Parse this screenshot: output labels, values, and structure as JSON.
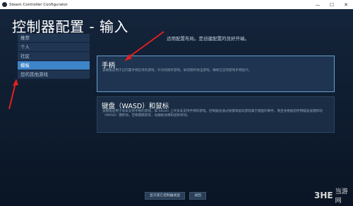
{
  "window": {
    "title": "Steam Controller Configurator",
    "buttons": [
      "—",
      "☐",
      "✕"
    ]
  },
  "page_title": "控制器配置 - 输入",
  "sidebar": {
    "items": [
      {
        "label": "推荐",
        "active": false
      },
      {
        "label": "个人",
        "active": false
      },
      {
        "label": "社区",
        "active": false
      },
      {
        "label": "模板",
        "active": true
      },
      {
        "label": "您的其他游戏",
        "active": false
      }
    ]
  },
  "hint": "适用配置布局。是创建配置的良好开端。",
  "cards": [
    {
      "title": "手柄",
      "desc": "该模板适用于已内置手柄支持的游戏。针对双摇杆游戏，如双摇杆射击游戏，确保已支持游戏手柄设计。",
      "selected": true
    },
    {
      "title": "键盘（WASD）和鼠标",
      "desc": "该模板适用于尚未支持手柄的游戏，如 Steam 上许多未支持手柄的游戏。控制器会通过按键来驱动游戏属于键盘的事件，而且会根据您所用瞄准按键移动（WASD）键移动，空格键跳跃等，右触板会模拟鼠标移动。",
      "selected": false
    }
  ],
  "bottom_buttons": [
    "显示其它控制器类型",
    "返回"
  ],
  "watermark": {
    "logo": "3HE",
    "text": "当游网"
  },
  "colors": {
    "accent": "#3e84c8",
    "arrow": "#e02020"
  }
}
